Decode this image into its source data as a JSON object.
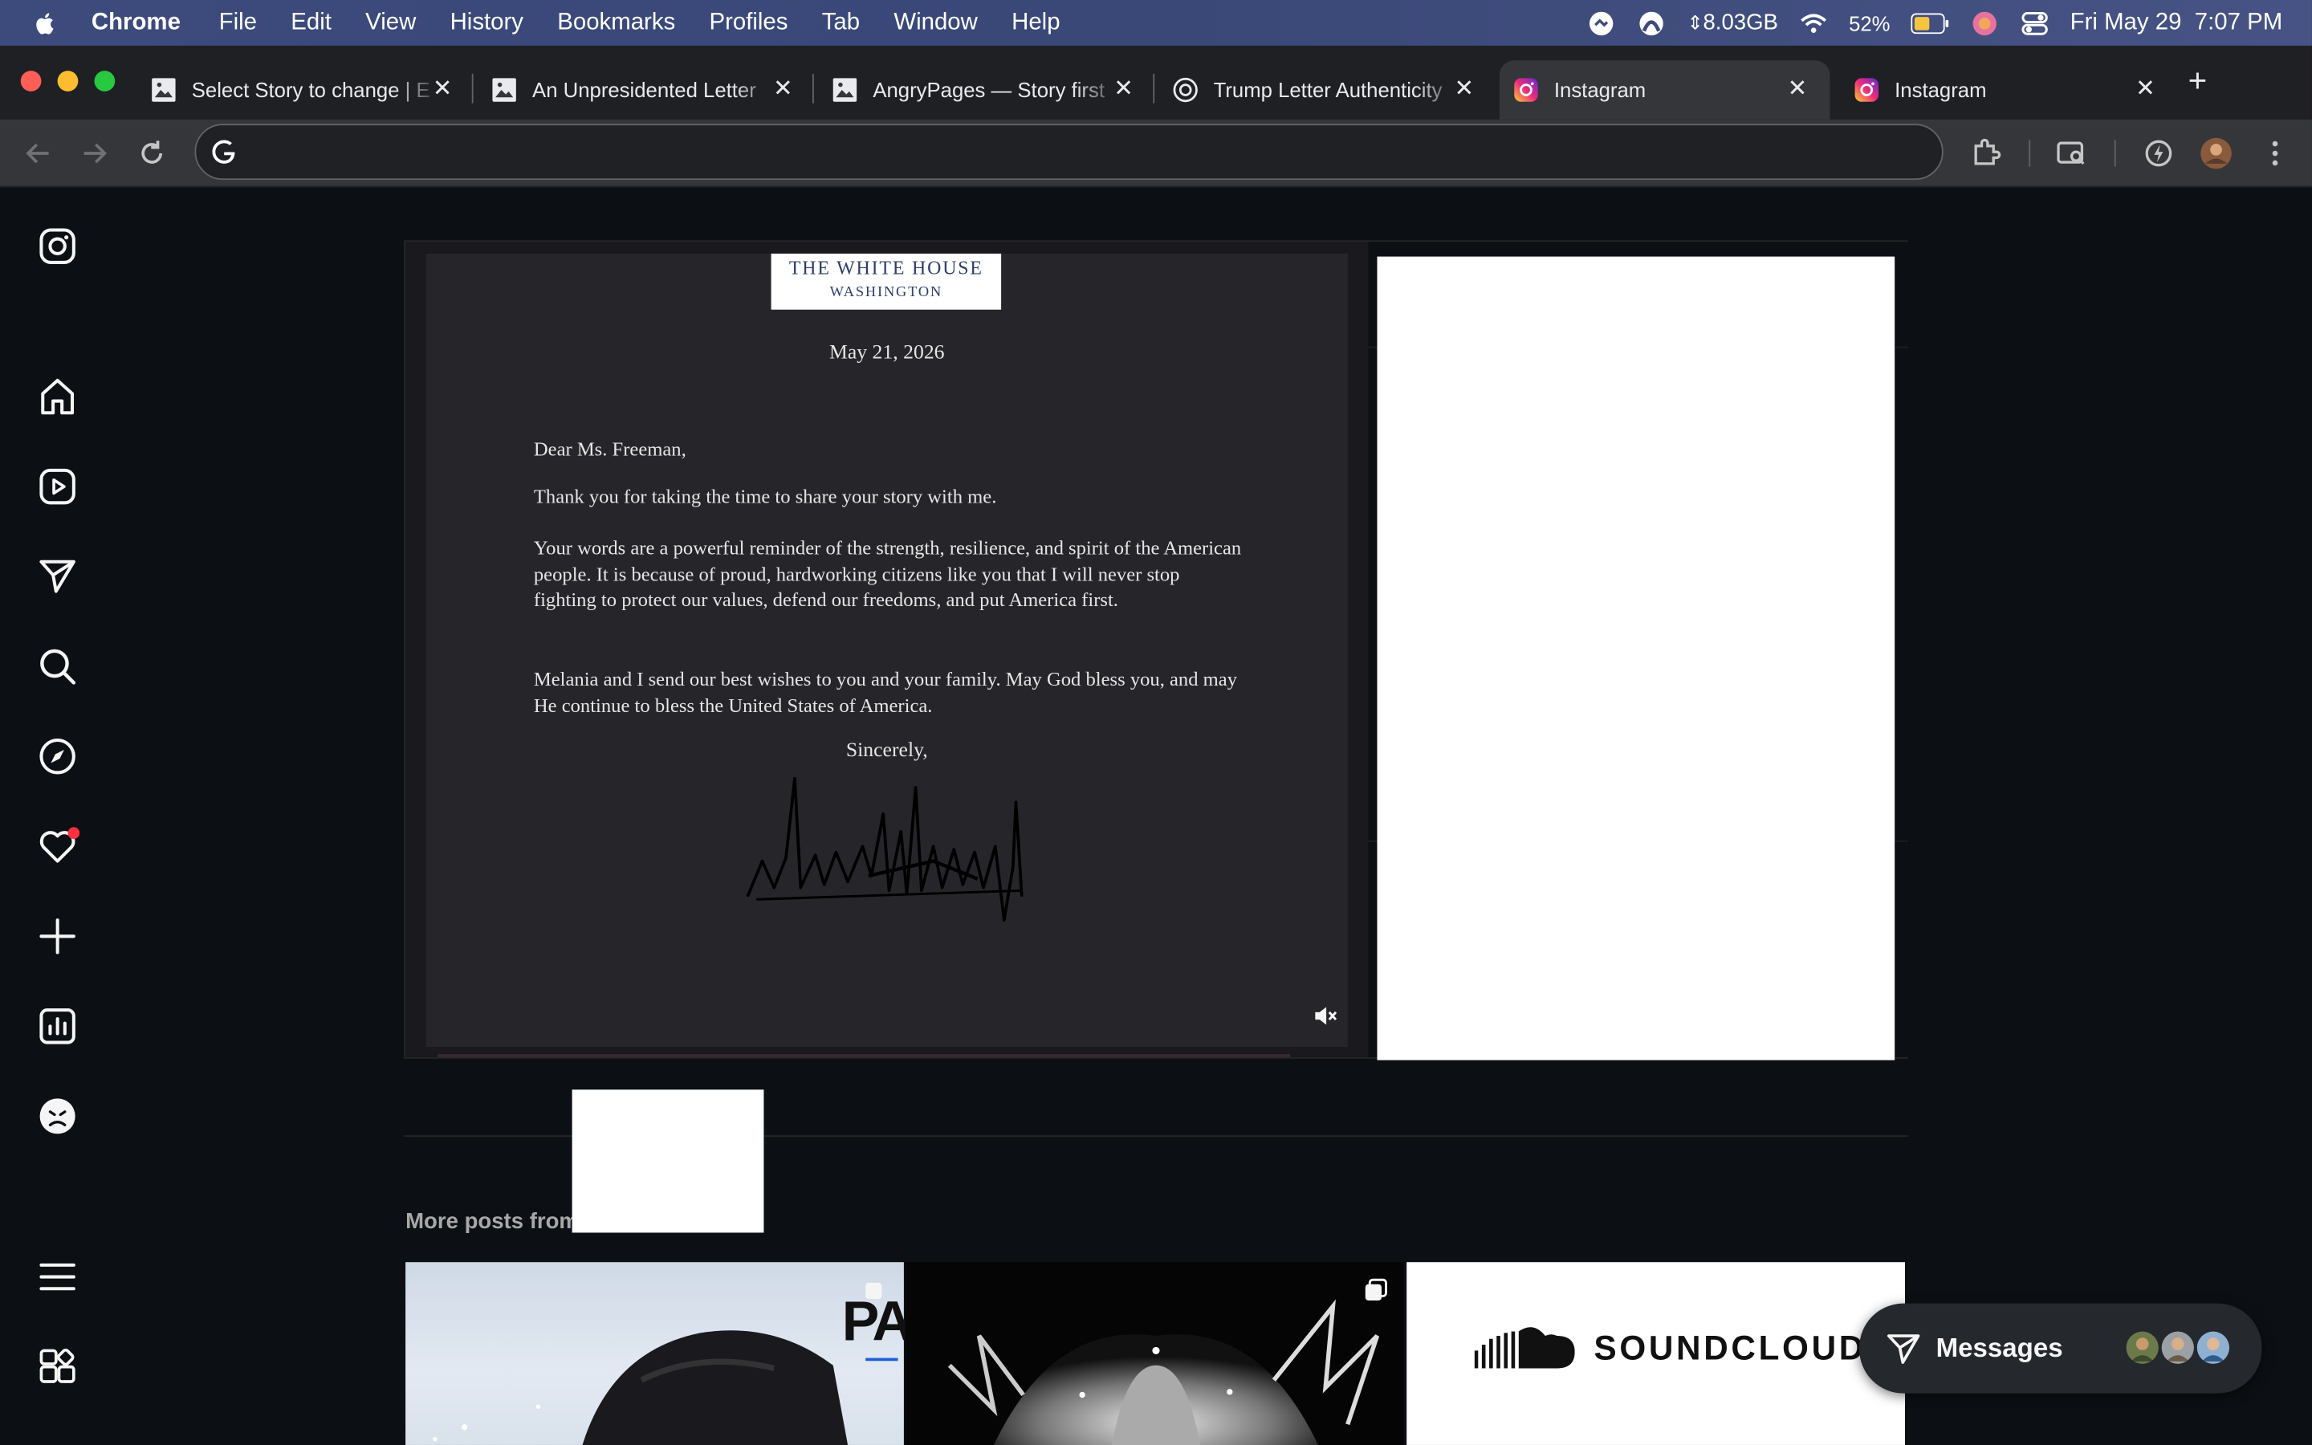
{
  "menubar": {
    "app": "Chrome",
    "items": [
      "File",
      "Edit",
      "View",
      "History",
      "Bookmarks",
      "Profiles",
      "Tab",
      "Window",
      "Help"
    ],
    "memory": "8.03GB",
    "memory_arrow": "⇕",
    "battery": "52%",
    "datetime": "Fri May 29  7:07 PM"
  },
  "tabs": [
    {
      "title": "Select Story to change | E",
      "icon": "broken-image-icon"
    },
    {
      "title": "An Unpresidented Letter",
      "icon": "broken-image-icon"
    },
    {
      "title": "AngryPages — Story first",
      "icon": "broken-image-icon"
    },
    {
      "title": "Trump Letter Authenticity",
      "icon": "openai-icon"
    },
    {
      "title": "Instagram",
      "icon": "instagram-icon",
      "active": true
    },
    {
      "title": "Instagram",
      "icon": "instagram-icon"
    }
  ],
  "toolbar": {
    "url": ""
  },
  "letter": {
    "letterhead_1": "THE WHITE HOUSE",
    "letterhead_2": "WASHINGTON",
    "date": "May 21, 2026",
    "salutation": "Dear Ms. Freeman,",
    "para1": "Thank you for taking the time to share your story with me.",
    "para2": "Your words are a powerful reminder of the strength, resilience, and spirit of the American people.  It is because of proud, hardworking citizens like you that I will never stop fighting to protect our values, defend our freedoms, and put America first.",
    "para3": "Melania and I send our best wishes to you and your family.  May God bless you, and may He continue to bless the United States of America.",
    "closing": "Sincerely,"
  },
  "more_posts": {
    "label": "More posts from",
    "thumb1_text": "PAL",
    "thumb3_text": "SOUNDCLOUD"
  },
  "messages": {
    "label": "Messages"
  },
  "colors": {
    "accent_notification": "#ff3040",
    "page_bg": "#0c1014"
  }
}
